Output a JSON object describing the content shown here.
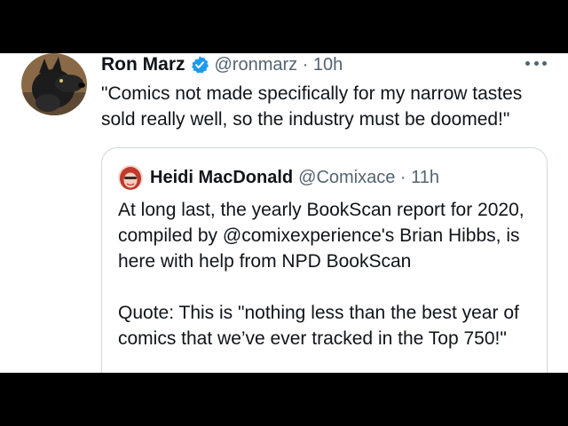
{
  "tweet": {
    "author": {
      "display_name": "Ron Marz",
      "verified_icon": "verified-badge-icon",
      "handle_time": "@ronmarz · 10h"
    },
    "more_icon": "more-options-icon",
    "text": "\"Comics not made specifically for my narrow tastes sold really well, so the industry must be doomed!\""
  },
  "quoted_tweet": {
    "author": {
      "display_name": "Heidi MacDonald",
      "handle_time": "@Comixace · 11h"
    },
    "paragraphs": [
      "At long last, the yearly BookScan report for 2020, compiled by @comixexperience's Brian Hibbs, is here with help from NPD BookScan",
      "Quote: This is \"nothing less than the best year of comics that we’ve ever tracked in the Top 750!\""
    ]
  },
  "colors": {
    "text_primary": "#0f1419",
    "text_secondary": "#536471",
    "verified_blue": "#1d9bf0",
    "card_border": "#cfd9de"
  }
}
